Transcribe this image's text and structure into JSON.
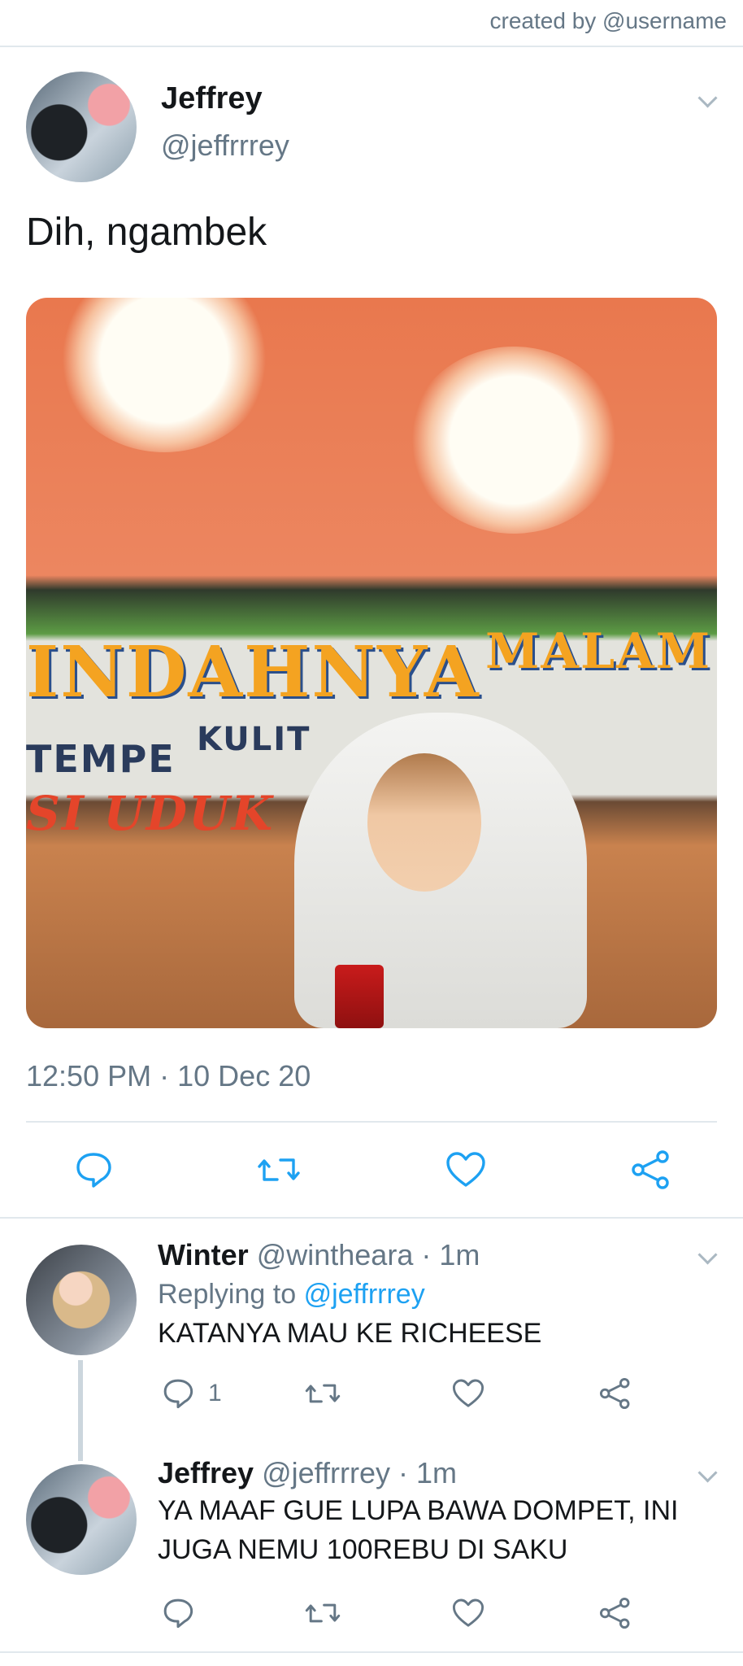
{
  "header": {
    "credit": "created by @username"
  },
  "tweet": {
    "author_name": "Jeffrey",
    "author_handle": "@jeffrrrey",
    "text": "Dih, ngambek",
    "photo_signage": {
      "line1": "INDAHNYA",
      "line2": "MALAM",
      "menu1": "TEMPE",
      "menu2": "KULIT",
      "menu3": "SI UDUK"
    },
    "time": "12:50 PM",
    "date": "10 Dec 20",
    "meta_sep": "·"
  },
  "actions": [
    "reply-icon",
    "retweet-icon",
    "like-icon",
    "share-icon"
  ],
  "replies": [
    {
      "name": "Winter",
      "handle": "@wintheara",
      "sep": "·",
      "time": "1m",
      "replying_label": "Replying to",
      "replying_handle": "@jeffrrrey",
      "text": "KATANYA MAU KE RICHEESE",
      "reply_count": "1"
    },
    {
      "name": "Jeffrey",
      "handle": "@jeffrrrey",
      "sep": "·",
      "time": "1m",
      "text_line1": "YA MAAF GUE LUPA BAWA DOMPET, INI",
      "text_line2": "JUGA NEMU 100REBU DI SAKU"
    }
  ],
  "colors": {
    "accent": "#1da1f2",
    "muted": "#657786",
    "divider": "#e1e8ed"
  }
}
